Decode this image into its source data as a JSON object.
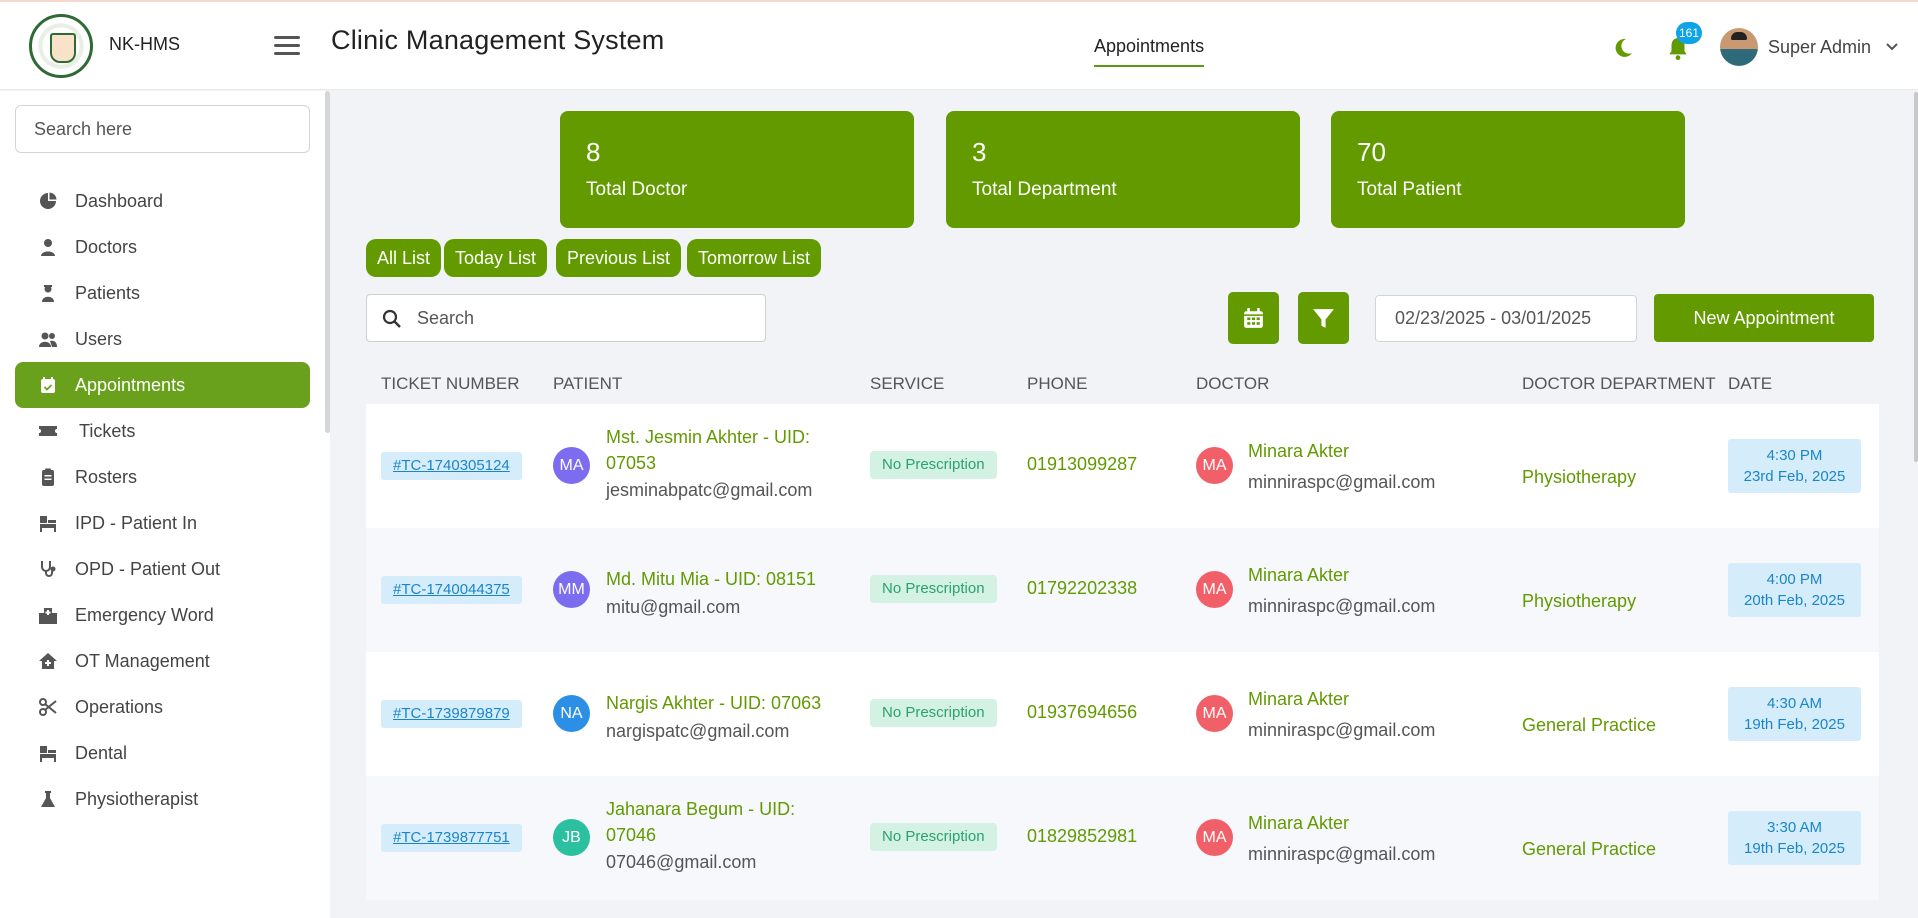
{
  "app": {
    "brand": "NK-HMS",
    "title": "Clinic Management System"
  },
  "header": {
    "nav_tab": "Appointments",
    "notification_count": "161",
    "user_name": "Super Admin"
  },
  "sidebar": {
    "search_placeholder": "Search here",
    "items": [
      {
        "label": "Dashboard",
        "icon": "pie-chart-icon",
        "active": false
      },
      {
        "label": "Doctors",
        "icon": "doctor-icon",
        "active": false
      },
      {
        "label": "Patients",
        "icon": "patient-icon",
        "active": false
      },
      {
        "label": "Users",
        "icon": "users-icon",
        "active": false
      },
      {
        "label": "Appointments",
        "icon": "calendar-check-icon",
        "active": true
      },
      {
        "label": "Tickets",
        "icon": "ticket-icon",
        "active": false
      },
      {
        "label": "Rosters",
        "icon": "clipboard-icon",
        "active": false
      },
      {
        "label": "IPD - Patient In",
        "icon": "bed-icon",
        "active": false
      },
      {
        "label": "OPD - Patient Out",
        "icon": "stethoscope-icon",
        "active": false
      },
      {
        "label": "Emergency Word",
        "icon": "hospital-icon",
        "active": false
      },
      {
        "label": "OT Management",
        "icon": "house-medical-icon",
        "active": false
      },
      {
        "label": "Operations",
        "icon": "scissors-icon",
        "active": false
      },
      {
        "label": "Dental",
        "icon": "dental-bed-icon",
        "active": false
      },
      {
        "label": "Physiotherapist",
        "icon": "flask-icon",
        "active": false
      }
    ]
  },
  "stats": [
    {
      "value": "8",
      "label": "Total Doctor"
    },
    {
      "value": "3",
      "label": "Total Department"
    },
    {
      "value": "70",
      "label": "Total Patient"
    }
  ],
  "filters": [
    "All List",
    "Today List",
    "Previous List",
    "Tomorrow List"
  ],
  "toolbar": {
    "search_placeholder": "Search",
    "date_range": "02/23/2025 - 03/01/2025",
    "new_button": "New Appointment"
  },
  "table": {
    "columns": [
      "TICKET NUMBER",
      "PATIENT",
      "SERVICE",
      "PHONE",
      "DOCTOR",
      "DOCTOR DEPARTMENT",
      "DATE"
    ],
    "rows": [
      {
        "ticket": "#TC-1740305124",
        "patient_initials": "MA",
        "patient_color": "#7c6cf0",
        "patient_name": "Mst. Jesmin Akhter - UID: 07053",
        "patient_email": "jesminabpatc@gmail.com",
        "service": "No Prescription",
        "phone": "01913099287",
        "doctor_initials": "MA",
        "doctor_name": "Minara Akter",
        "doctor_email": "minniraspc@gmail.com",
        "department": "Physiotherapy",
        "time": "4:30 PM",
        "date": "23rd Feb, 2025"
      },
      {
        "ticket": "#TC-1740044375",
        "patient_initials": "MM",
        "patient_color": "#7c6cf0",
        "patient_name": "Md. Mitu Mia - UID: 08151",
        "patient_email": "mitu@gmail.com",
        "service": "No Prescription",
        "phone": "01792202338",
        "doctor_initials": "MA",
        "doctor_name": "Minara Akter",
        "doctor_email": "minniraspc@gmail.com",
        "department": "Physiotherapy",
        "time": "4:00 PM",
        "date": "20th Feb, 2025"
      },
      {
        "ticket": "#TC-1739879879",
        "patient_initials": "NA",
        "patient_color": "#2c8fe6",
        "patient_name": "Nargis Akhter - UID: 07063",
        "patient_email": "nargispatc@gmail.com",
        "service": "No Prescription",
        "phone": "01937694656",
        "doctor_initials": "MA",
        "doctor_name": "Minara Akter",
        "doctor_email": "minniraspc@gmail.com",
        "department": "General Practice",
        "time": "4:30 AM",
        "date": "19th Feb, 2025"
      },
      {
        "ticket": "#TC-1739877751",
        "patient_initials": "JB",
        "patient_color": "#2bc0a0",
        "patient_name": "Jahanara Begum - UID: 07046",
        "patient_email": "07046@gmail.com",
        "service": "No Prescription",
        "phone": "01829852981",
        "doctor_initials": "MA",
        "doctor_name": "Minara Akter",
        "doctor_email": "minniraspc@gmail.com",
        "department": "General Practice",
        "time": "3:30 AM",
        "date": "19th Feb, 2025"
      }
    ]
  },
  "colors": {
    "primary": "#629a00",
    "active_nav": "#6aa11c",
    "link_blue": "#1a86c9",
    "badge_blue": "#0fa3e8"
  }
}
